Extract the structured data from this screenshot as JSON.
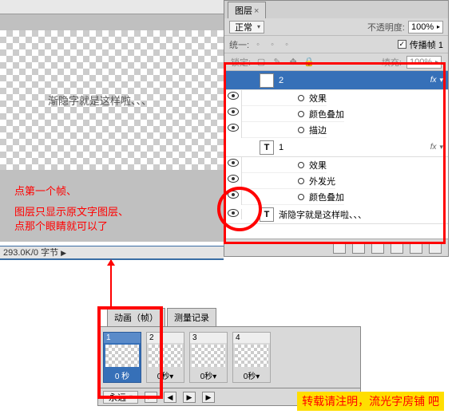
{
  "canvas": {
    "text": "渐隐字就是这样啦、、、"
  },
  "annotations": {
    "line1": "点第一个帧、",
    "line2": "图层只显示原文字图层、",
    "line3": "点那个眼睛就可以了"
  },
  "status": "293.0K/0 字节",
  "layers_panel": {
    "tab": "图层",
    "blend_label": "正常",
    "opacity_label": "不透明度:",
    "opacity_value": "100%",
    "unify_label": "统一:",
    "propagate_checked": "✓",
    "propagate_label": "传播帧 1",
    "lock_label": "锁定:",
    "fill_label": "填充:",
    "fill_value": "100%",
    "layers": [
      {
        "name": "2",
        "type": "T",
        "selected": true,
        "fx": true,
        "subs": [
          "效果",
          "颜色叠加",
          "描边"
        ]
      },
      {
        "name": "1",
        "type": "T",
        "selected": false,
        "fx": true,
        "subs": [
          "效果",
          "外发光",
          "颜色叠加"
        ]
      },
      {
        "name": "渐隐字就是这样啦、、、",
        "type": "T",
        "selected": false,
        "visible": true,
        "subs": []
      }
    ]
  },
  "animation": {
    "tab1": "动画（帧）",
    "tab2": "测量记录",
    "frames": [
      {
        "num": "1",
        "delay": "0 秒",
        "selected": true
      },
      {
        "num": "2",
        "delay": "0秒▾",
        "selected": false
      },
      {
        "num": "3",
        "delay": "0秒▾",
        "selected": false
      },
      {
        "num": "4",
        "delay": "0秒▾",
        "selected": false
      }
    ],
    "loop": "永远"
  },
  "watermark": "转载请注明，流光字房铺 吧"
}
